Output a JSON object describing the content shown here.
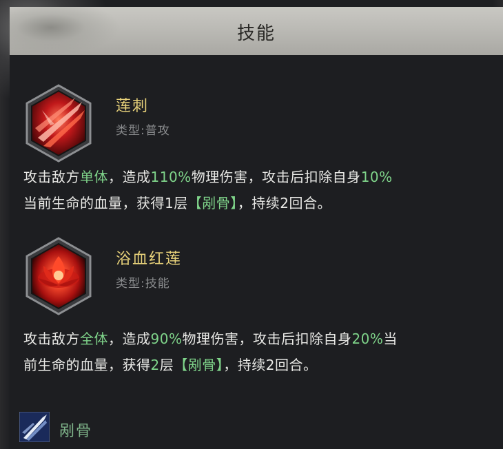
{
  "header": {
    "title": "技能"
  },
  "skills": [
    {
      "name": "莲刺",
      "type": "类型:普攻",
      "icon": "crimson-slash-icon",
      "desc": {
        "l1a": "攻击敌方",
        "l1b": "单体",
        "l1c": "，造成",
        "l1d": "110%",
        "l1e": "物理伤害，攻击后扣除自身",
        "l1f": "10%",
        "l2a": "当前生命的血量，获得1层",
        "l2b": "【剐骨】",
        "l2c": "，持续2回合。"
      }
    },
    {
      "name": "浴血红莲",
      "type": "类型:技能",
      "icon": "blood-lotus-icon",
      "desc": {
        "l1a": "攻击敌方",
        "l1b": "全体",
        "l1c": "，造成",
        "l1d": "90%",
        "l1e": "物理伤害，攻击后扣除自身",
        "l1f": "20%",
        "l1g": "当",
        "l2a": "前生命的血量，获得",
        "l2b": "2",
        "l2c": "层",
        "l2d": "【剐骨】",
        "l2e": "，持续2回合。"
      }
    }
  ],
  "effect": {
    "name": "剐骨",
    "icon": "bone-blade-icon"
  },
  "colors": {
    "accent_name": "#e8d27a",
    "highlight": "#7fd48a",
    "text": "#e9e9e6",
    "muted": "#8a8c8e"
  }
}
